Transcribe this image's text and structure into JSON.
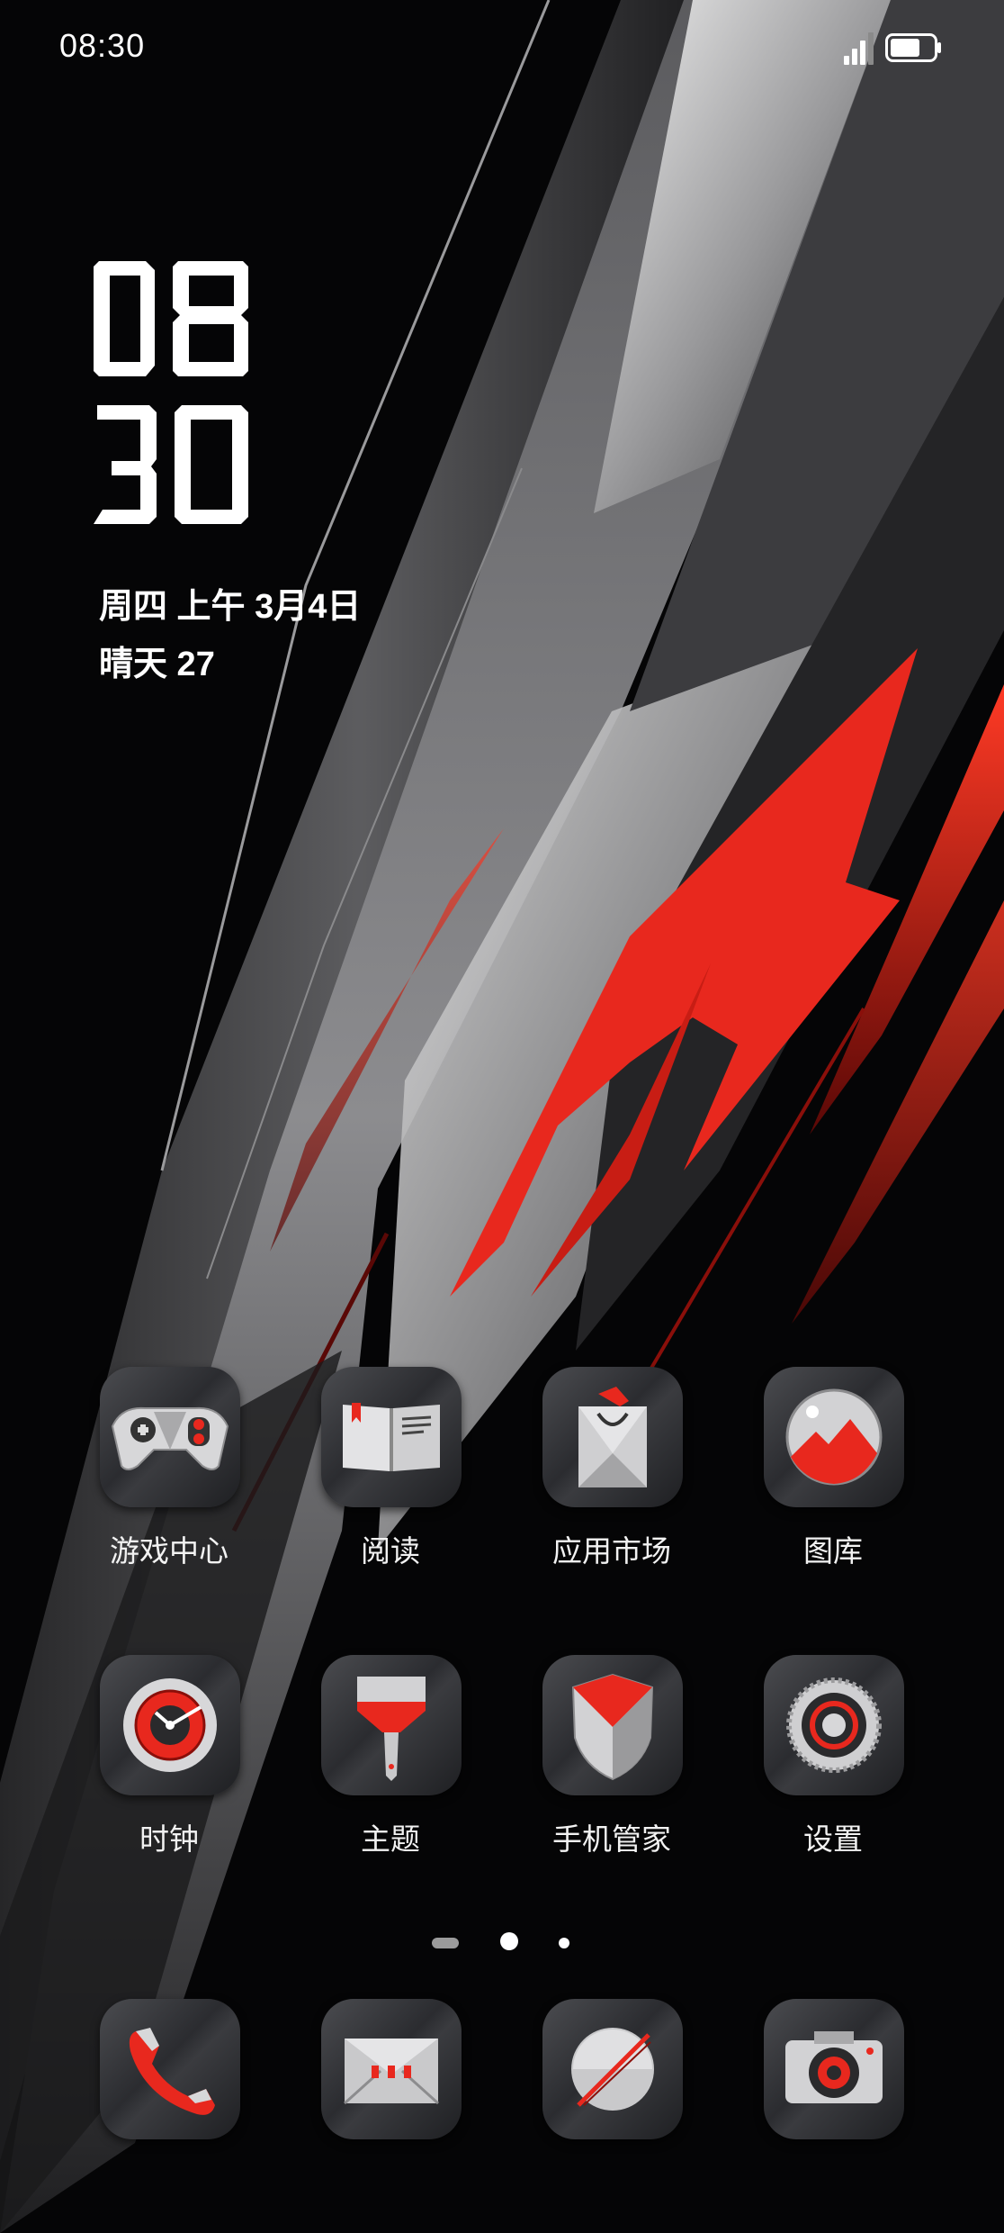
{
  "status_bar": {
    "time": "08:30",
    "signal_icon": "cellular-signal-icon",
    "battery_icon": "battery-icon",
    "battery_level": 0.7
  },
  "widget": {
    "clock_hours": "08",
    "clock_minutes": "30",
    "date": "周四 上午  3月4日",
    "weather": "晴天 27"
  },
  "apps": [
    {
      "label": "游戏中心",
      "icon": "gamepad-icon"
    },
    {
      "label": "阅读",
      "icon": "book-icon"
    },
    {
      "label": "应用市场",
      "icon": "shopping-bag-icon"
    },
    {
      "label": "图库",
      "icon": "gallery-icon"
    },
    {
      "label": "时钟",
      "icon": "clock-icon"
    },
    {
      "label": "主题",
      "icon": "paintbrush-icon"
    },
    {
      "label": "手机管家",
      "icon": "shield-icon"
    },
    {
      "label": "设置",
      "icon": "gear-icon"
    }
  ],
  "dock": [
    {
      "icon": "phone-icon"
    },
    {
      "icon": "messages-icon"
    },
    {
      "icon": "browser-compass-icon"
    },
    {
      "icon": "camera-icon"
    }
  ],
  "pager": {
    "pages": 3,
    "current": 2
  },
  "colors": {
    "accent_red": "#e8281e",
    "background": "#050506",
    "metal_light": "#d9d9db",
    "metal_dark": "#2b2c30"
  }
}
